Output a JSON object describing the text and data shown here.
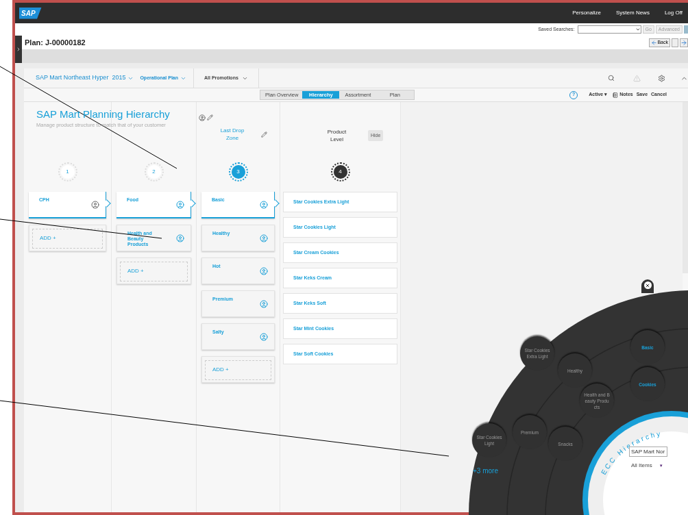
{
  "header": {
    "logo": "SAP",
    "links": [
      "Personalize",
      "System News",
      "Log Off"
    ]
  },
  "search_bar": {
    "label": "Saved Searches:",
    "buttons": [
      "Go",
      "Advanced"
    ]
  },
  "plan": {
    "title": "Plan: J-00000182",
    "back": "Back"
  },
  "toolbar": {
    "store": "SAP Mart Northeast Hyper",
    "year": "2015",
    "plan_type": "Operational Plan",
    "promotions": "All Promotions"
  },
  "view_tabs": [
    {
      "label": "Plan Overview",
      "selected": false
    },
    {
      "label": "Hierarchy",
      "selected": true
    },
    {
      "label": "Assortment",
      "selected": false
    },
    {
      "label": "Plan",
      "selected": false
    }
  ],
  "actions": {
    "help": "?",
    "status": "Active",
    "status_caret": "▾",
    "notes": "Notes",
    "save": "Save",
    "cancel": "Cancel"
  },
  "hierarchy": {
    "title": "SAP Mart Planning Hierarchy",
    "subtitle": "Manage product structure to match that of your customer",
    "columns": [
      {
        "number": "1",
        "kind": "plain",
        "items": [
          {
            "label": "CPH",
            "selected": true,
            "assigned": false
          }
        ],
        "add": "ADD +"
      },
      {
        "number": "2",
        "kind": "plain",
        "items": [
          {
            "label": "Food",
            "selected": true,
            "assigned": true
          },
          {
            "label": "Health and Beauty Products",
            "selected": false,
            "assigned": true
          }
        ],
        "add": "ADD +"
      },
      {
        "number": "3",
        "kind": "active",
        "heading": "Last Drop Zone",
        "items": [
          {
            "label": "Basic",
            "selected": true,
            "assigned": true
          },
          {
            "label": "Healthy",
            "selected": false,
            "assigned": true
          },
          {
            "label": "Hot",
            "selected": false,
            "assigned": true
          },
          {
            "label": "Premium",
            "selected": false,
            "assigned": true
          },
          {
            "label": "Salty",
            "selected": false,
            "assigned": true
          }
        ],
        "add": "ADD +"
      },
      {
        "number": "4",
        "kind": "product",
        "heading": "Product Level",
        "hide": "Hide",
        "products": [
          "Star Cookies Extra Light",
          "Star Cookies Light",
          "Star Cream Cookies",
          "Star Keks Cream",
          "Star Keks Soft",
          "Star Mint Cookies",
          "Star Soft Cookies"
        ]
      }
    ]
  },
  "radial": {
    "title": "ECC Hierarchy",
    "field_value": "SAP Mart Nor",
    "filter": "All Items",
    "filter_caret": "▼",
    "more": "+3 more",
    "nodes": [
      {
        "label": "Star Cookies Extra Light",
        "highlighted": false
      },
      {
        "label": "Healthy",
        "highlighted": false
      },
      {
        "label": "Basic",
        "highlighted": true
      },
      {
        "label": "Cookies",
        "highlighted": true
      },
      {
        "label": "Health and Beauty Products",
        "highlighted": false
      },
      {
        "label": "Star Cookies Light",
        "highlighted": false
      },
      {
        "label": "Premium",
        "highlighted": false
      },
      {
        "label": "Snacks",
        "highlighted": false
      }
    ]
  }
}
